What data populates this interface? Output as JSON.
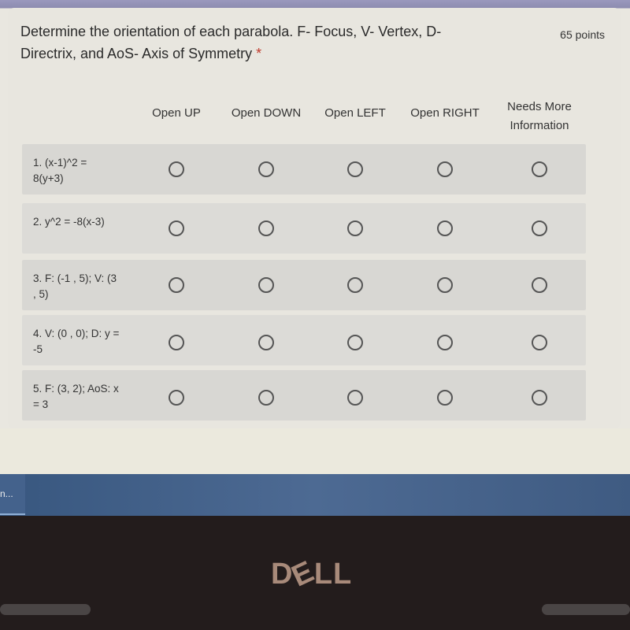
{
  "question": {
    "title": "Determine the orientation of each parabola. F- Focus, V- Vertex, D-Directrix, and AoS- Axis of Symmetry",
    "required_marker": "*",
    "points": "65 points"
  },
  "columns": [
    "Open UP",
    "Open DOWN",
    "Open LEFT",
    "Open RIGHT",
    "Needs More Information"
  ],
  "rows": [
    {
      "label": "1. (x-1)^2 = 8(y+3)"
    },
    {
      "label": "2. y^2 = -8(x-3)"
    },
    {
      "label": "3. F: (-1 , 5); V: (3 , 5)"
    },
    {
      "label": "4. V: (0 , 0); D: y = -5"
    },
    {
      "label": "5. F: (3, 2); AoS: x = 3"
    }
  ],
  "taskbar": {
    "item_label": "n..."
  },
  "bezel": {
    "logo": "DELL"
  },
  "colors": {
    "taskbar": "#4d6a93",
    "card": "#e8e6df",
    "row": "#d8d7d3"
  }
}
